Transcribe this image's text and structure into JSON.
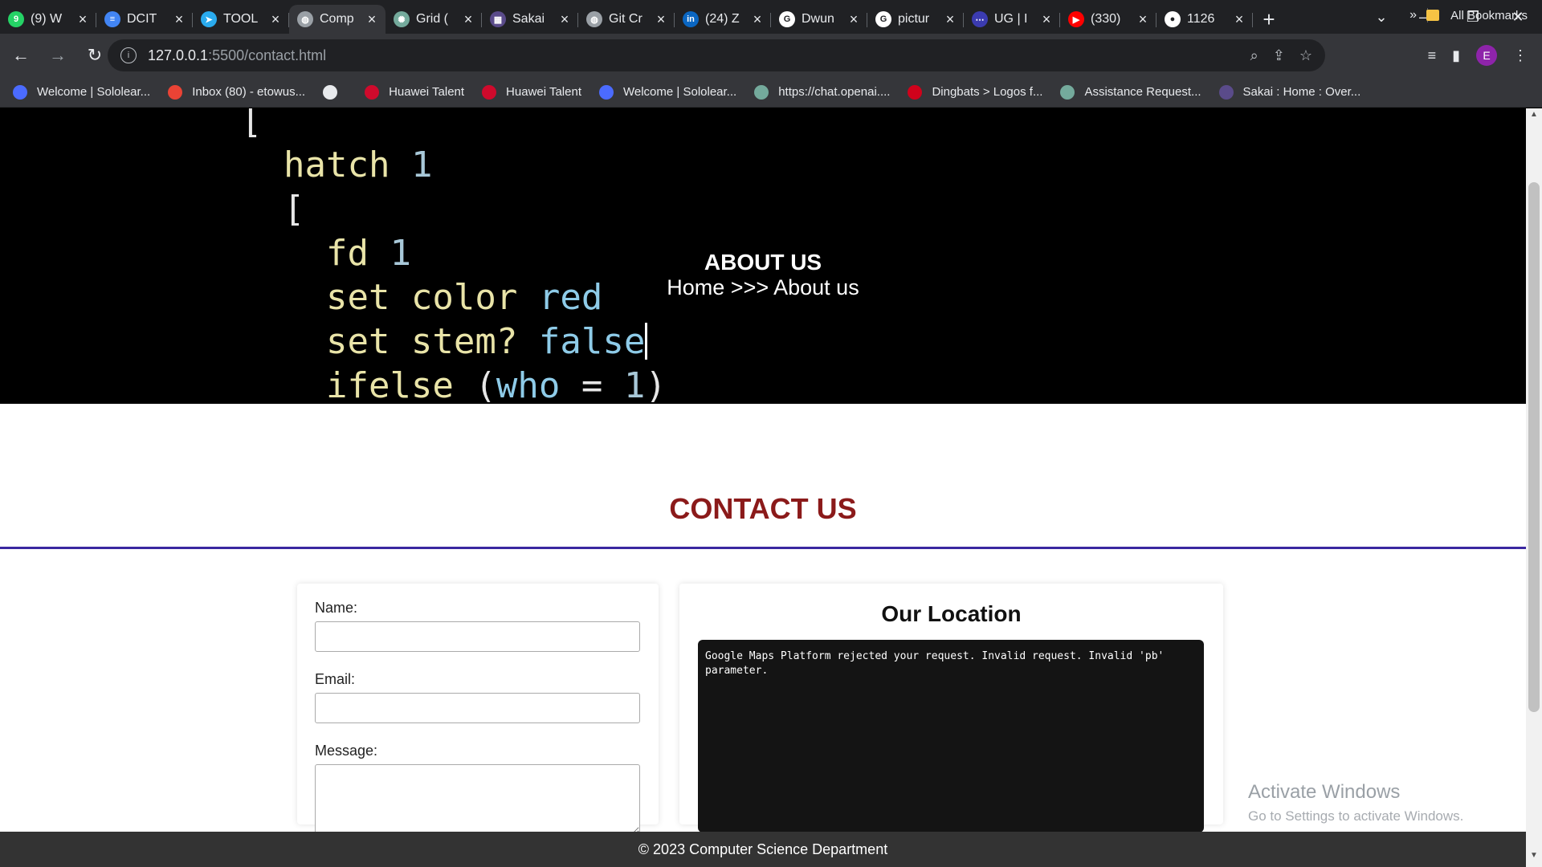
{
  "browser": {
    "tabs": [
      {
        "label": "(9) W",
        "icon": "whatsapp-icon",
        "color": "#25d366",
        "glyph": "9"
      },
      {
        "label": "DCIT",
        "icon": "docs-icon",
        "color": "#4285f4",
        "glyph": "≡"
      },
      {
        "label": "TOOL",
        "icon": "telegram-icon",
        "color": "#2aabee",
        "glyph": "➤"
      },
      {
        "label": "Comp",
        "icon": "globe-icon",
        "color": "#9aa0a6",
        "glyph": "◍",
        "active": true
      },
      {
        "label": "Grid (",
        "icon": "chatgpt-icon",
        "color": "#74aa9c",
        "glyph": "✺"
      },
      {
        "label": "Sakai",
        "icon": "sakai-icon",
        "color": "#5a4b8a",
        "glyph": "▦"
      },
      {
        "label": "Git Cr",
        "icon": "globe-icon",
        "color": "#9aa0a6",
        "glyph": "◍"
      },
      {
        "label": "(24) Z",
        "icon": "linkedin-icon",
        "color": "#0a66c2",
        "glyph": "in"
      },
      {
        "label": "Dwun",
        "icon": "google-icon",
        "color": "#ffffff",
        "glyph": "G"
      },
      {
        "label": "pictur",
        "icon": "google-icon",
        "color": "#ffffff",
        "glyph": "G"
      },
      {
        "label": "UG | I",
        "icon": "ug-icon",
        "color": "#3b3bb0",
        "glyph": "⋯"
      },
      {
        "label": "(330)",
        "icon": "youtube-icon",
        "color": "#ff0000",
        "glyph": "▶"
      },
      {
        "label": "1126",
        "icon": "github-icon",
        "color": "#ffffff",
        "glyph": "●"
      }
    ],
    "url_host": "127.0.0.1",
    "url_path": ":5500/contact.html",
    "profile_initial": "E",
    "bookmarks": [
      {
        "label": "Welcome | Sololear...",
        "icon": "sololearn-icon",
        "color": "#4b6bff"
      },
      {
        "label": "Inbox (80) - etowus...",
        "icon": "gmail-icon",
        "color": "#ea4335"
      },
      {
        "label": "",
        "icon": "globe-icon",
        "color": "#e8eaed"
      },
      {
        "label": "Huawei Talent",
        "icon": "huawei-icon",
        "color": "#cf0a2c"
      },
      {
        "label": "Huawei Talent",
        "icon": "huawei-icon",
        "color": "#cf0a2c"
      },
      {
        "label": "Welcome | Sololear...",
        "icon": "sololearn-icon",
        "color": "#4b6bff"
      },
      {
        "label": "https://chat.openai....",
        "icon": "chatgpt-icon",
        "color": "#74aa9c"
      },
      {
        "label": "Dingbats > Logos f...",
        "icon": "dingbats-icon",
        "color": "#d0021b"
      },
      {
        "label": "Assistance Request...",
        "icon": "chatgpt-icon",
        "color": "#74aa9c"
      },
      {
        "label": "Sakai : Home : Over...",
        "icon": "sakai-icon",
        "color": "#5a4b8a"
      }
    ],
    "bookmarks_more": "»",
    "all_bookmarks": "All Bookmarks"
  },
  "page": {
    "hero": {
      "code_lines": [
        "[",
        "  hatch 1",
        "  [",
        "    fd 1",
        "    set color red",
        "    set stem? false",
        "    ifelse (who = 1)"
      ],
      "title": "ABOUT US",
      "breadcrumb": "Home >>> About us"
    },
    "contact_heading": "CONTACT US",
    "form": {
      "name_label": "Name:",
      "email_label": "Email:",
      "message_label": "Message:"
    },
    "map": {
      "title": "Our Location",
      "error": "Google Maps Platform rejected your request. Invalid request. Invalid 'pb' parameter."
    },
    "footer": "© 2023 Computer Science Department"
  },
  "os": {
    "watermark_title": "Activate Windows",
    "watermark_sub": "Go to Settings to activate Windows."
  }
}
